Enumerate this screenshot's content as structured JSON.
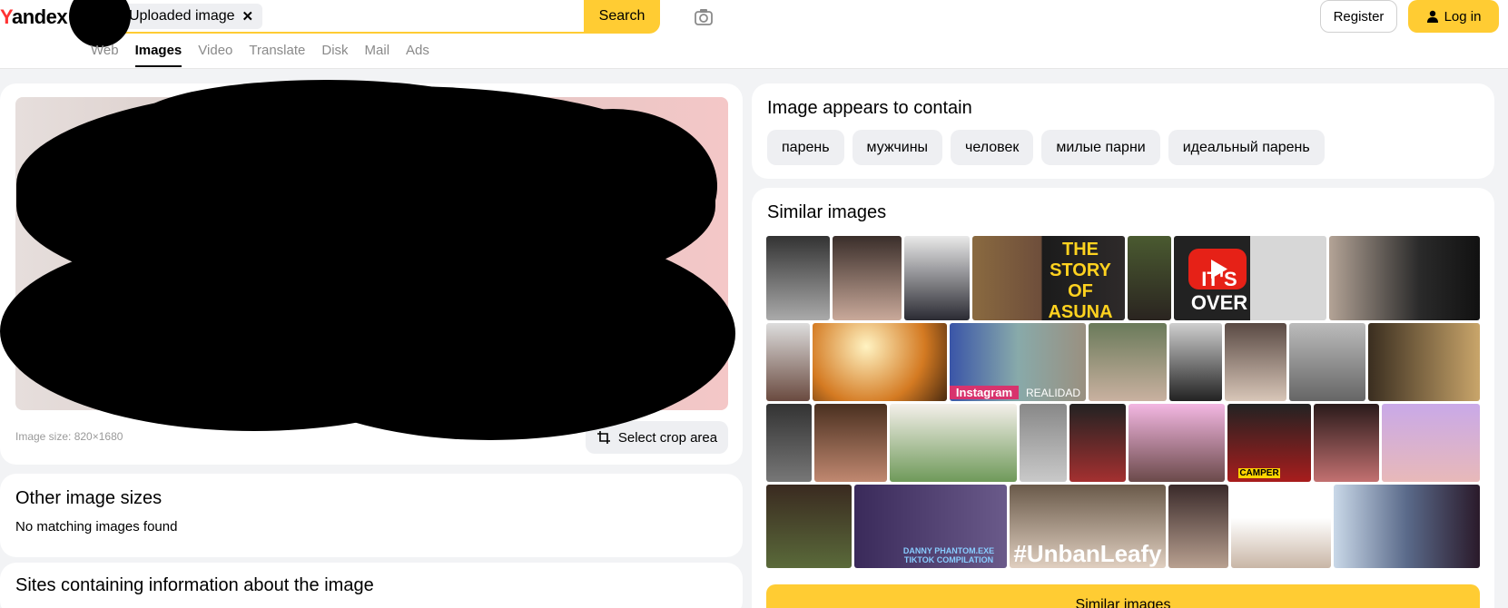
{
  "header": {
    "logo": "Yandex",
    "search_chip": "Uploaded image",
    "search_chip_close": "✕",
    "search_button": "Search",
    "register": "Register",
    "login": "Log in",
    "nav": [
      "Web",
      "Images",
      "Video",
      "Translate",
      "Disk",
      "Mail",
      "Ads"
    ],
    "nav_active": "Images"
  },
  "main": {
    "image_size": "Image size: 820×1680",
    "crop_button": "Select crop area"
  },
  "other_sizes": {
    "title": "Other image sizes",
    "message": "No matching images found"
  },
  "sites": {
    "title": "Sites containing information about the image"
  },
  "contains": {
    "title": "Image appears to contain",
    "tags": [
      "парень",
      "мужчины",
      "человек",
      "милые парни",
      "идеальный парень"
    ]
  },
  "similar": {
    "title": "Similar images",
    "button": "Similar images",
    "thumb_captions": [
      "THE STORY OF ASUNA",
      "IT'S OVER",
      "Instagram",
      "REALIDAD",
      "CAMPER",
      "#UnbanLeafy",
      "DANNY PHANTOM.EXE TIKTOK COMPILATION"
    ]
  },
  "colors": {
    "accent": "#ffcc33",
    "logo_red": "#ff3333",
    "page_bg": "#f2f3f5"
  },
  "icons": [
    "camera-icon",
    "user-icon",
    "crop-icon",
    "close-icon",
    "play-icon"
  ]
}
